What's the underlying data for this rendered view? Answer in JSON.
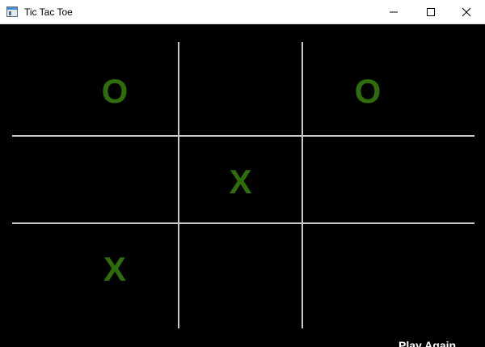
{
  "window": {
    "title": "Tic Tac Toe",
    "icon": "window-app-icon",
    "controls": [
      "minimize-icon",
      "maximize-icon",
      "close-icon"
    ]
  },
  "board": {
    "cells": [
      "O",
      "",
      "O",
      "",
      "X",
      "",
      "X",
      "",
      ""
    ],
    "mark_color": "#2d6e0a",
    "grid_color": "#c8c8c8",
    "background": "#000000"
  },
  "actions": {
    "play_again_label": "Play Again"
  }
}
